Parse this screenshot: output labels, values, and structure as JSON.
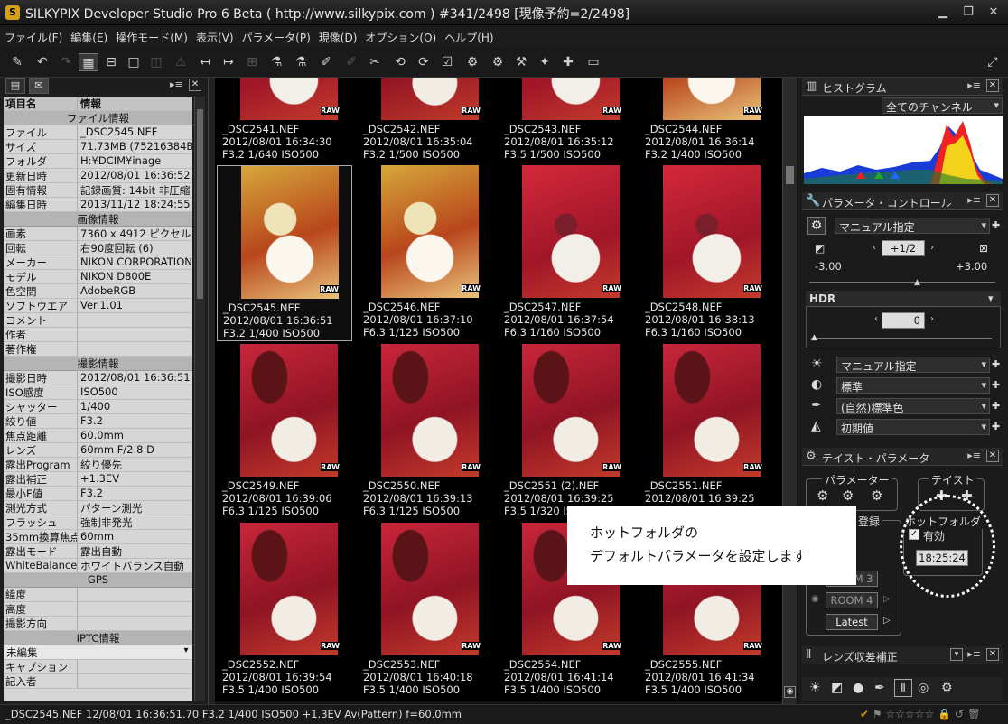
{
  "window": {
    "title": "SILKYPIX Developer Studio Pro 6 Beta ( http://www.silkypix.com )   #341/2498 [現像予約=2/2498]"
  },
  "menu": [
    "ファイル(F)",
    "編集(E)",
    "操作モード(M)",
    "表示(V)",
    "パラメータ(P)",
    "現像(D)",
    "オプション(O)",
    "ヘルプ(H)"
  ],
  "info": {
    "col_item": "項目名",
    "col_info": "情報",
    "sections": [
      {
        "title": "ファイル情報",
        "rows": [
          [
            "ファイル",
            "_DSC2545.NEF"
          ],
          [
            "サイズ",
            "71.73MB (75216384Byte)"
          ],
          [
            "フォルダ",
            "H:¥DCIM¥inage"
          ],
          [
            "更新日時",
            "2012/08/01 16:36:52"
          ],
          [
            "固有情報",
            "記録画質: 14bit 非圧縮"
          ],
          [
            "編集日時",
            "2013/11/12 18:24:55"
          ]
        ]
      },
      {
        "title": "画像情報",
        "rows": [
          [
            "画素",
            "7360 x 4912 ピクセル"
          ],
          [
            "回転",
            "右90度回転 (6)"
          ],
          [
            "メーカー",
            "NIKON CORPORATION"
          ],
          [
            "モデル",
            "NIKON D800E"
          ],
          [
            "色空間",
            "AdobeRGB"
          ],
          [
            "ソフトウエア",
            "Ver.1.01"
          ],
          [
            "コメント",
            ""
          ],
          [
            "作者",
            ""
          ],
          [
            "著作権",
            ""
          ]
        ]
      },
      {
        "title": "撮影情報",
        "rows": [
          [
            "撮影日時",
            "2012/08/01 16:36:51"
          ],
          [
            "ISO感度",
            "ISO500"
          ],
          [
            "シャッター",
            "1/400"
          ],
          [
            "絞り値",
            "F3.2"
          ],
          [
            "焦点距離",
            "60.0mm"
          ],
          [
            "レンズ",
            "60mm F/2.8 D"
          ],
          [
            "露出Program",
            "絞り優先"
          ],
          [
            "露出補正",
            "+1.3EV"
          ],
          [
            "最小F値",
            "F3.2"
          ],
          [
            "測光方式",
            "パターン測光"
          ],
          [
            "フラッシュ",
            "強制非発光"
          ],
          [
            "35mm換算焦点距離",
            "60mm"
          ],
          [
            "露出モード",
            "露出自動"
          ],
          [
            "WhiteBalance",
            "ホワイトバランス自動"
          ]
        ]
      },
      {
        "title": "GPS",
        "rows": [
          [
            "緯度",
            ""
          ],
          [
            "高度",
            ""
          ],
          [
            "撮影方向",
            ""
          ]
        ]
      },
      {
        "title": "IPTC情報",
        "rows": []
      }
    ],
    "iptc_select": "未編集",
    "iptc_rows": [
      [
        "キャプション",
        ""
      ],
      [
        "記入者",
        ""
      ]
    ]
  },
  "thumbs": [
    {
      "name": "_DSC2541.NEF",
      "date": "2012/08/01 16:34:30",
      "exp": "F3.2  1/640   ISO500"
    },
    {
      "name": "_DSC2542.NEF",
      "date": "2012/08/01 16:35:04",
      "exp": "F3.2  1/500   ISO500"
    },
    {
      "name": "_DSC2543.NEF",
      "date": "2012/08/01 16:35:12",
      "exp": "F3.5  1/500   ISO500"
    },
    {
      "name": "_DSC2544.NEF",
      "date": "2012/08/01 16:36:14",
      "exp": "F3.2  1/400   ISO500"
    },
    {
      "name": "_DSC2545.NEF",
      "date": "2012/08/01 16:36:51",
      "exp": "F3.2  1/400   ISO500"
    },
    {
      "name": "_DSC2546.NEF",
      "date": "2012/08/01 16:37:10",
      "exp": "F6.3  1/125   ISO500"
    },
    {
      "name": "_DSC2547.NEF",
      "date": "2012/08/01 16:37:54",
      "exp": "F6.3  1/160   ISO500"
    },
    {
      "name": "_DSC2548.NEF",
      "date": "2012/08/01 16:38:13",
      "exp": "F6.3  1/160   ISO500"
    },
    {
      "name": "_DSC2549.NEF",
      "date": "2012/08/01 16:39:06",
      "exp": "F6.3  1/125   ISO500"
    },
    {
      "name": "_DSC2550.NEF",
      "date": "2012/08/01 16:39:13",
      "exp": "F6.3  1/125   ISO500"
    },
    {
      "name": "_DSC2551 (2).NEF",
      "date": "2012/08/01 16:39:25",
      "exp": "F3.5  1/320   ISO500"
    },
    {
      "name": "_DSC2551.NEF",
      "date": "2012/08/01 16:39:25",
      "exp": "F3.5  1/320   ISO500"
    },
    {
      "name": "_DSC2552.NEF",
      "date": "2012/08/01 16:39:54",
      "exp": "F3.5  1/400   ISO500"
    },
    {
      "name": "_DSC2553.NEF",
      "date": "2012/08/01 16:40:18",
      "exp": "F3.5  1/400   ISO500"
    },
    {
      "name": "_DSC2554.NEF",
      "date": "2012/08/01 16:41:14",
      "exp": "F3.5  1/400   ISO500"
    },
    {
      "name": "_DSC2555.NEF",
      "date": "2012/08/01 16:41:34",
      "exp": "F3.5  1/400   ISO500"
    }
  ],
  "raw_badge": "RAW",
  "right": {
    "histogram": {
      "title": "ヒストグラム",
      "channel": "全てのチャンネル"
    },
    "param": {
      "title": "パラメータ・コントロール",
      "preset": "マニュアル指定",
      "exposure_value": "+1/2",
      "min": "-3.00",
      "max": "+3.00"
    },
    "hdr": {
      "label": "HDR",
      "value": "0"
    },
    "rows": [
      {
        "icon": "sun-icon",
        "value": "マニュアル指定"
      },
      {
        "icon": "contrast-icon",
        "value": "標準"
      },
      {
        "icon": "dropper-icon",
        "value": "(自然)標準色"
      },
      {
        "icon": "sharpness-icon",
        "value": "初期値"
      }
    ],
    "taste": {
      "title": "テイスト・パラメータ",
      "group_param": "パラメーター",
      "group_taste": "テイスト",
      "registry": "登録",
      "room3": "ROOM 3",
      "room4": "ROOM 4",
      "latest": "Latest",
      "hot_folder": "ホットフォルダ",
      "enabled": "有効",
      "time": "18:25:24"
    },
    "lens": {
      "title": "レンズ収差補正"
    }
  },
  "callout": {
    "line1": "ホットフォルダの",
    "line2": "デフォルトパラメータを設定します"
  },
  "status": "_DSC2545.NEF 12/08/01 16:36:51.70 F3.2  1/400   ISO500 +1.3EV Av(Pattern) f=60.0mm"
}
